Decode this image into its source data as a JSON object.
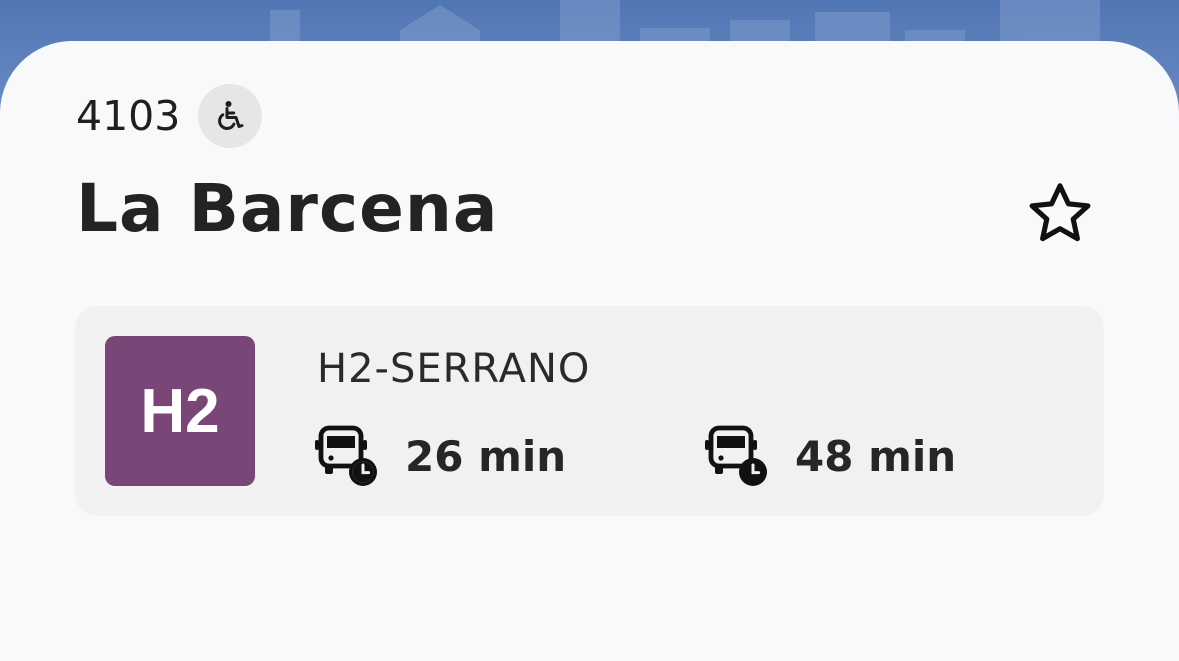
{
  "stop": {
    "code": "4103",
    "name": "La Barcena",
    "accessible_icon": "wheelchair-icon",
    "favorite_icon": "star-outline-icon"
  },
  "route": {
    "line": "H2",
    "line_color": "#7a4577",
    "name": "H2-SERRANO",
    "arrivals": [
      {
        "time": "26 min",
        "icon": "bus-clock-icon"
      },
      {
        "time": "48 min",
        "icon": "bus-clock-icon"
      }
    ]
  },
  "colors": {
    "header_blue": "#5a7fb8",
    "sheet_bg": "#f8f9fb",
    "card_bg": "#f1f1f1"
  }
}
